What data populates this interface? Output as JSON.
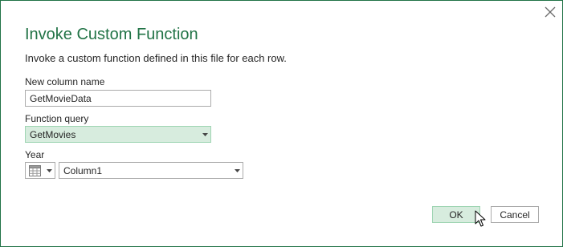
{
  "dialog": {
    "title": "Invoke Custom Function",
    "description": "Invoke a custom function defined in this file for each row."
  },
  "fields": {
    "new_column": {
      "label": "New column name",
      "value": "GetMovieData"
    },
    "function_query": {
      "label": "Function query",
      "value": "GetMovies"
    },
    "year": {
      "label": "Year",
      "value": "Column1"
    }
  },
  "buttons": {
    "ok": "OK",
    "cancel": "Cancel"
  },
  "colors": {
    "accent": "#217346",
    "selected_bg": "#d7ecde",
    "selected_border": "#9fd5b3"
  },
  "icons": {
    "close": "close-icon",
    "column_type": "table-icon",
    "dropdown": "chevron-down-icon",
    "cursor": "mouse-pointer-icon"
  }
}
